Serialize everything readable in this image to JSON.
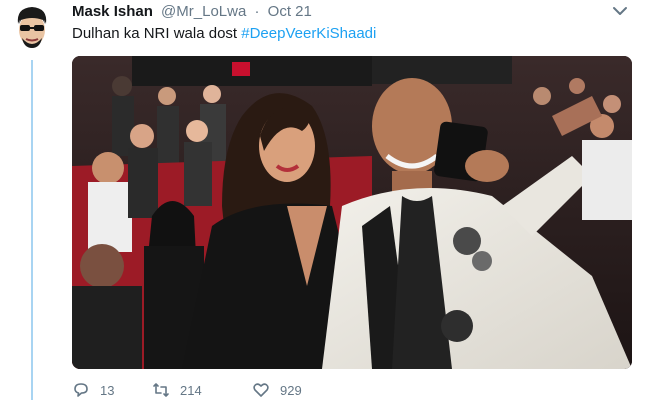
{
  "tweet": {
    "display_name": "Mask Ishan",
    "handle": "@Mr_LoLwa",
    "separator": "·",
    "timestamp": "Oct 21",
    "text_plain": "Dulhan ka NRI wala dost ",
    "hashtag": "#DeepVeerKiShaadi",
    "media_alt": "",
    "avatar_icon": "avatar-cartoon-icon",
    "menu_icon": "chevron-down-icon"
  },
  "actions": {
    "reply_count": "13",
    "retweet_count": "214",
    "like_count": "929",
    "reply_icon": "reply-icon",
    "retweet_icon": "retweet-icon",
    "like_icon": "heart-icon"
  },
  "colors": {
    "link": "#1da1f2",
    "thread_line": "#a8d4f2",
    "secondary_text": "#657786"
  }
}
